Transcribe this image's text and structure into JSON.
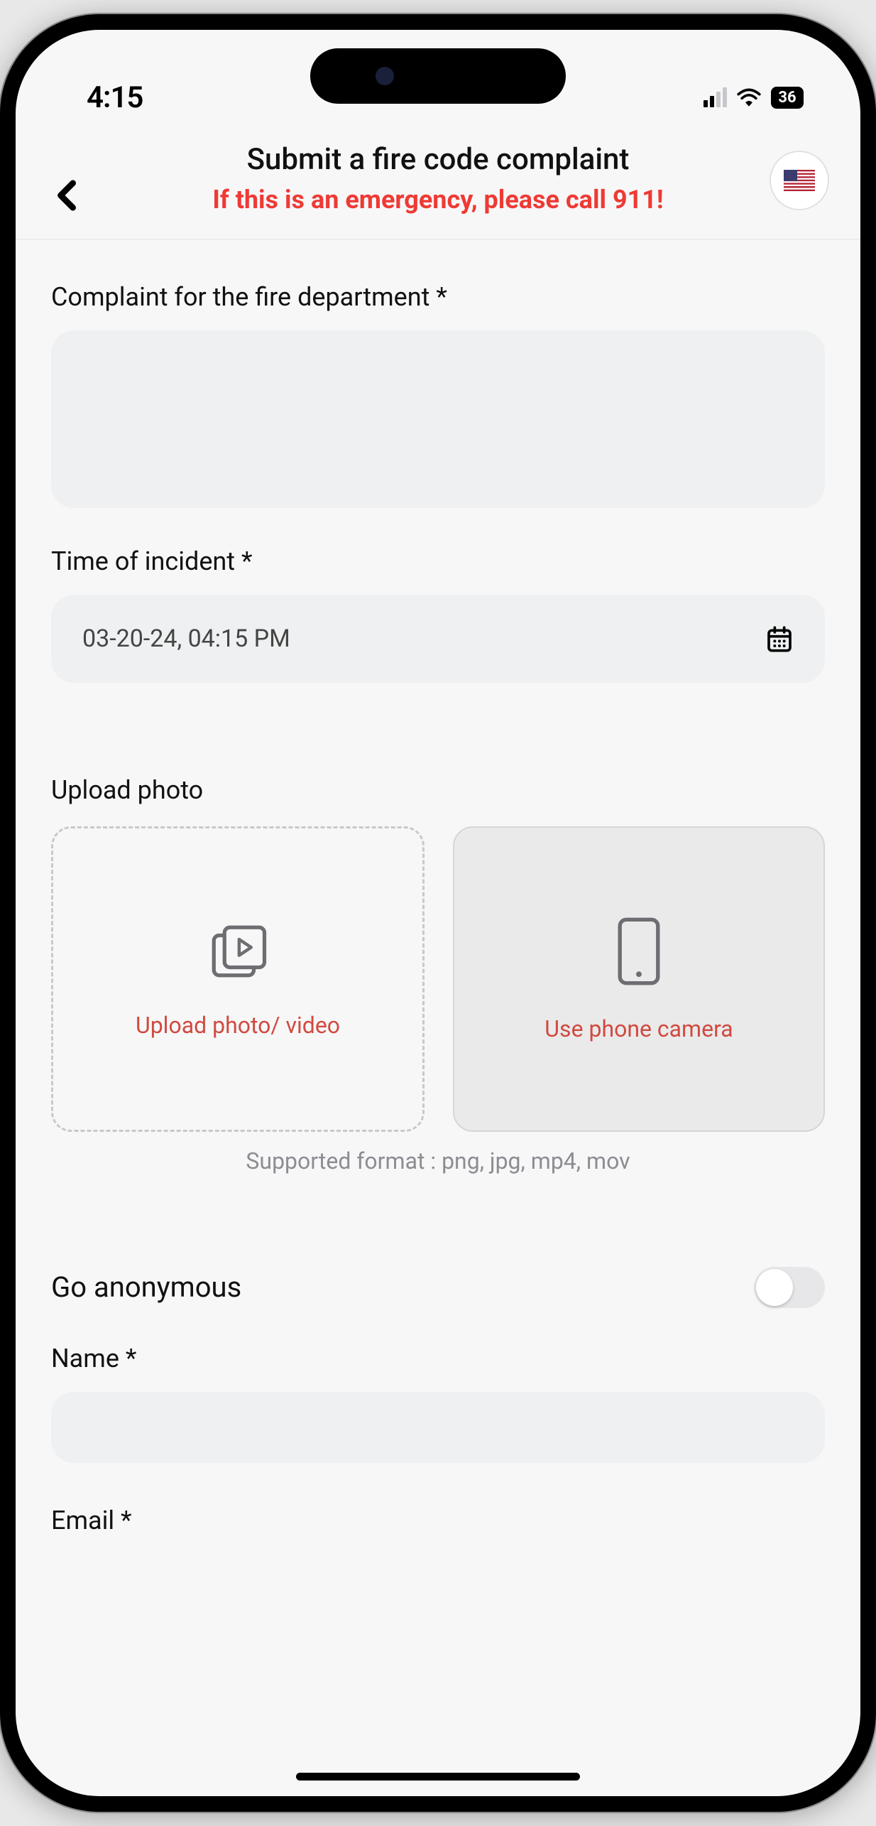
{
  "status": {
    "time": "4:15",
    "battery": "36"
  },
  "header": {
    "title": "Submit a fire code complaint",
    "subtitle": "If this is an emergency, please call 911!"
  },
  "form": {
    "complaint_label": "Complaint for the fire department *",
    "complaint_value": "",
    "time_label": "Time of incident *",
    "time_value": "03-20-24, 04:15 PM",
    "upload_label": "Upload photo",
    "upload_option1": "Upload photo/ video",
    "upload_option2": "Use phone camera",
    "supported_hint": "Supported format : png, jpg, mp4, mov",
    "anon_label": "Go anonymous",
    "name_label": "Name *",
    "name_value": "",
    "email_label": "Email *",
    "email_value": ""
  }
}
